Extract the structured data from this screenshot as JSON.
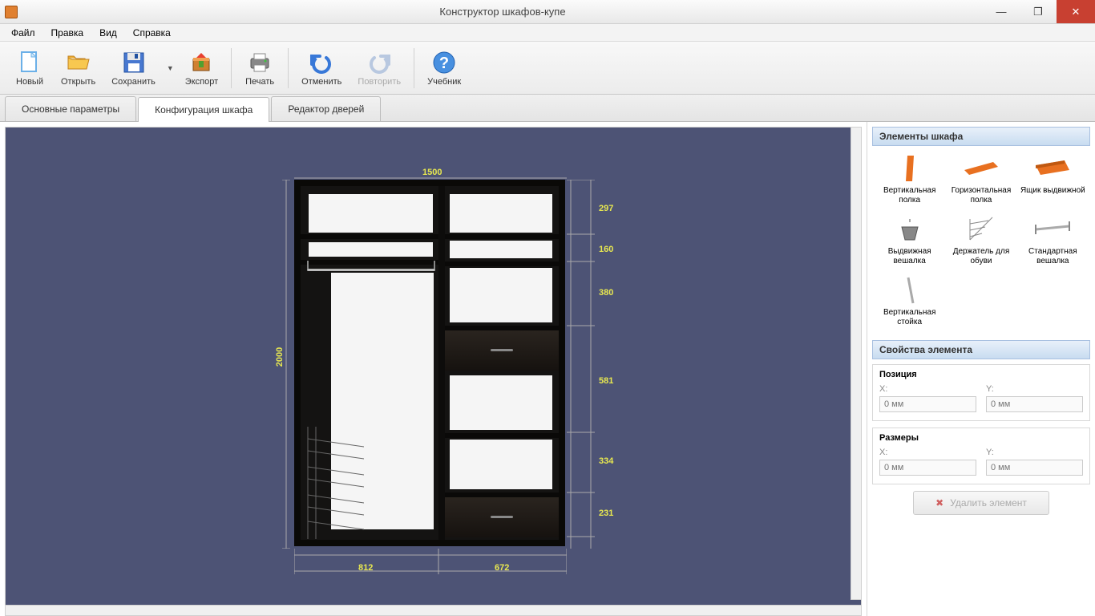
{
  "window": {
    "title": "Конструктор шкафов-купе"
  },
  "menu": {
    "file": "Файл",
    "edit": "Правка",
    "view": "Вид",
    "help": "Справка"
  },
  "toolbar": {
    "new": "Новый",
    "open": "Открыть",
    "save": "Сохранить",
    "export": "Экспорт",
    "print": "Печать",
    "undo": "Отменить",
    "redo": "Повторить",
    "tutorial": "Учебник"
  },
  "tabs": {
    "params": "Основные параметры",
    "config": "Конфигурация шкафа",
    "doors": "Редактор дверей"
  },
  "dimensions": {
    "height": "2000",
    "width_total": "1500",
    "left_w": "812",
    "right_w": "672",
    "right_heights": [
      "297",
      "160",
      "380",
      "581",
      "334",
      "231"
    ]
  },
  "panels": {
    "elements_header": "Элементы шкафа",
    "items": [
      {
        "label": "Вертикальная полка"
      },
      {
        "label": "Горизонтальная полка"
      },
      {
        "label": "Ящик выдвижной"
      },
      {
        "label": "Выдвижная вешалка"
      },
      {
        "label": "Держатель для обуви"
      },
      {
        "label": "Стандартная вешалка"
      },
      {
        "label": "Вертикальная стойка"
      }
    ],
    "props_header": "Свойства элемента",
    "position_title": "Позиция",
    "dimensions_title": "Размеры",
    "x_label": "X:",
    "y_label": "Y:",
    "placeholder": "0 мм",
    "delete_label": "Удалить элемент"
  }
}
